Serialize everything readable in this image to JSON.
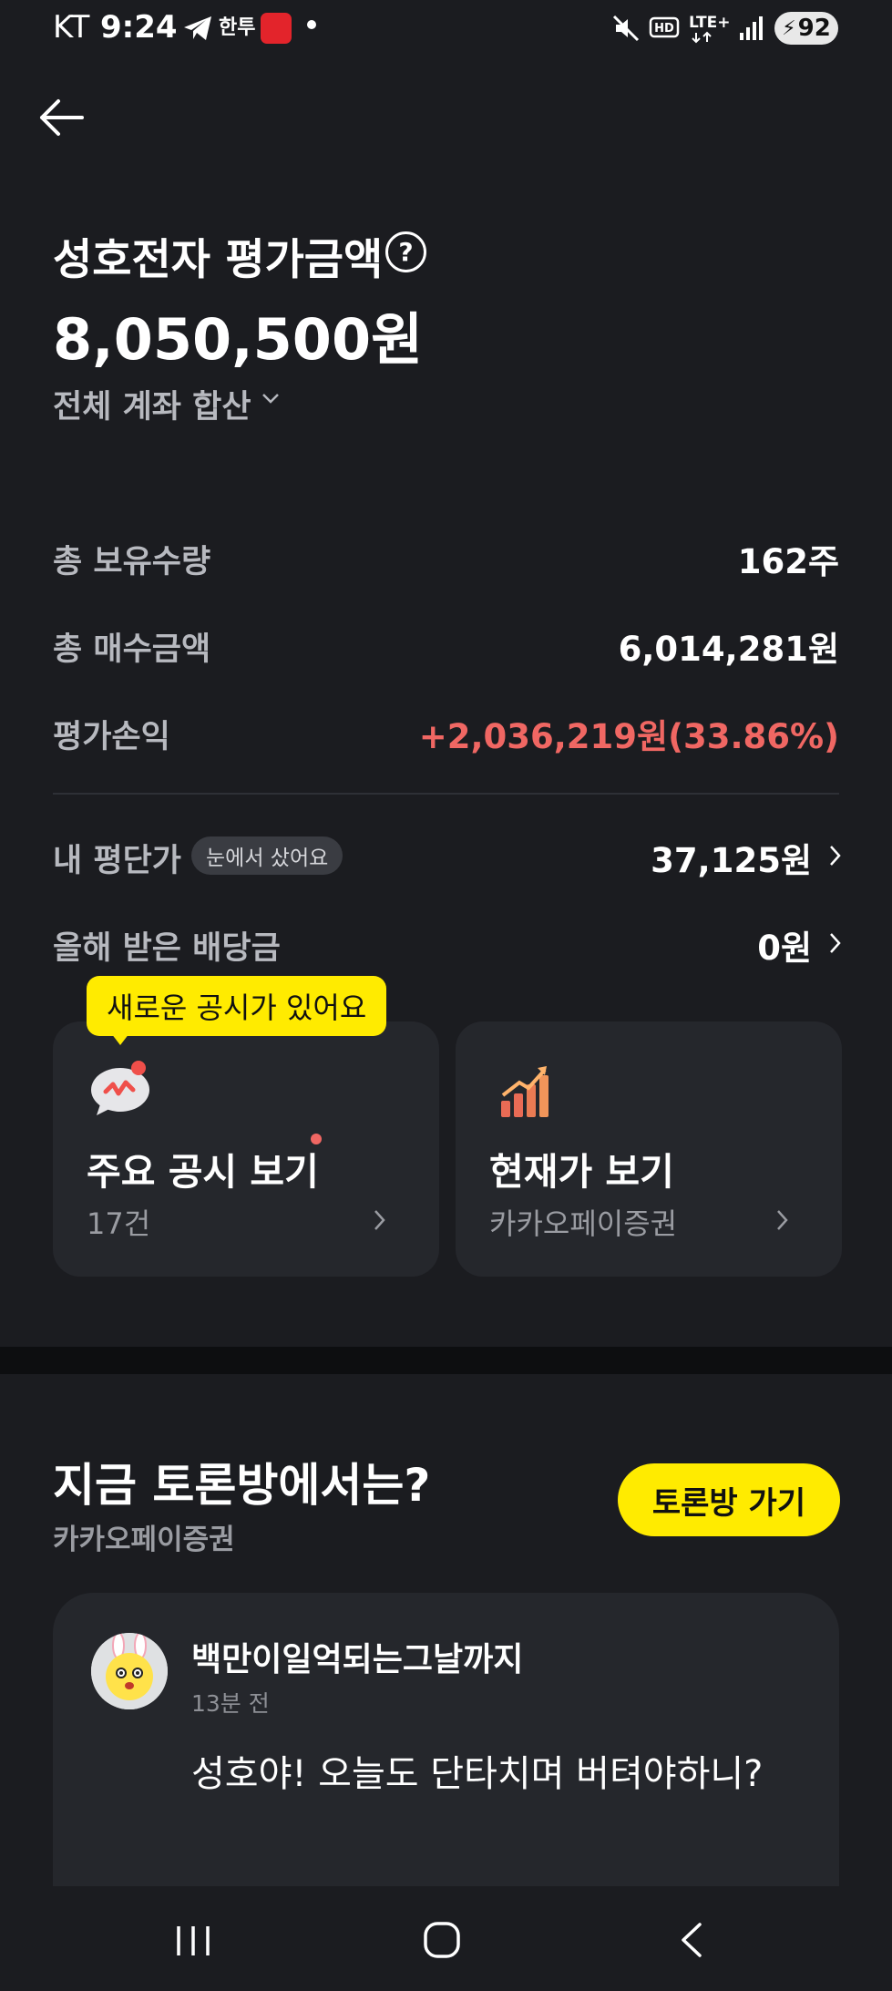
{
  "status_bar": {
    "carrier": "KT",
    "time": "9:24",
    "app_label": "한투",
    "battery": "92"
  },
  "header": {
    "title": "성호전자 평가금액",
    "amount": "8,050,500원",
    "account_scope": "전체 계좌 합산"
  },
  "summary": {
    "rows": [
      {
        "label": "총 보유수량",
        "value": "162주"
      },
      {
        "label": "총 매수금액",
        "value": "6,014,281원"
      },
      {
        "label": "평가손익",
        "value": "+2,036,219원(33.86%)"
      }
    ],
    "avg_price": {
      "label": "내 평단가",
      "badge": "눈에서 샀어요",
      "value": "37,125원"
    },
    "dividend": {
      "label": "올해 받은 배당금",
      "value": "0원"
    }
  },
  "tooltip": "새로운 공시가 있어요",
  "cards": [
    {
      "title": "주요 공시 보기",
      "sub": "17건"
    },
    {
      "title": "현재가 보기",
      "sub": "카카오페이증권"
    }
  ],
  "forum": {
    "title": "지금 토론방에서는?",
    "provider": "카카오페이증권",
    "button": "토론방 가기",
    "post": {
      "author": "백만이일억되는그날까지",
      "time": "13분 전",
      "body": "성호야! 오늘도 단타치며 버텨야하니?"
    }
  },
  "colors": {
    "background": "#1b1c20",
    "accent_yellow": "#ffeb00",
    "profit_red": "#f06763"
  }
}
